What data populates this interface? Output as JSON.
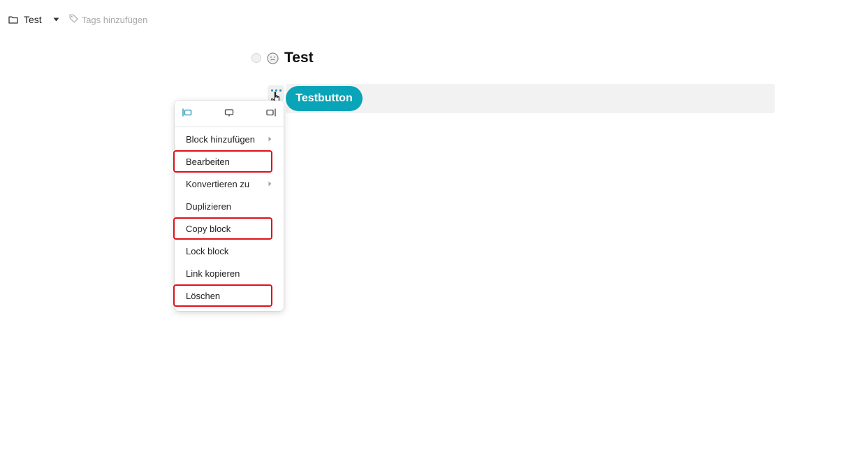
{
  "topbar": {
    "folder_icon": "folder-icon",
    "folder_name": "Test",
    "tags_icon": "tag-icon",
    "tags_placeholder": "Tags hinzufügen"
  },
  "document": {
    "title": "Test",
    "status_icon": "status-circle-icon",
    "emoji_icon": "smiley-icon"
  },
  "block": {
    "button_label": "Testbutton",
    "button_color": "#0aa4b8",
    "handle_icon": "more-dots-icon"
  },
  "menu": {
    "alignment_options": [
      "align-left-icon",
      "align-center-icon",
      "align-right-icon"
    ],
    "active_alignment": "align-left-icon",
    "items": [
      {
        "label": "Block hinzufügen",
        "has_submenu": true,
        "highlighted": false
      },
      {
        "label": "Bearbeiten",
        "has_submenu": false,
        "highlighted": true
      },
      {
        "label": "Konvertieren zu",
        "has_submenu": true,
        "highlighted": false
      },
      {
        "label": "Duplizieren",
        "has_submenu": false,
        "highlighted": false
      },
      {
        "label": "Copy block",
        "has_submenu": false,
        "highlighted": true
      },
      {
        "label": "Lock block",
        "has_submenu": false,
        "highlighted": false
      },
      {
        "label": "Link kopieren",
        "has_submenu": false,
        "highlighted": false
      },
      {
        "label": "Löschen",
        "has_submenu": false,
        "highlighted": true
      }
    ]
  },
  "colors": {
    "accent": "#0aa4b8",
    "highlight_box": "#e2101a"
  }
}
